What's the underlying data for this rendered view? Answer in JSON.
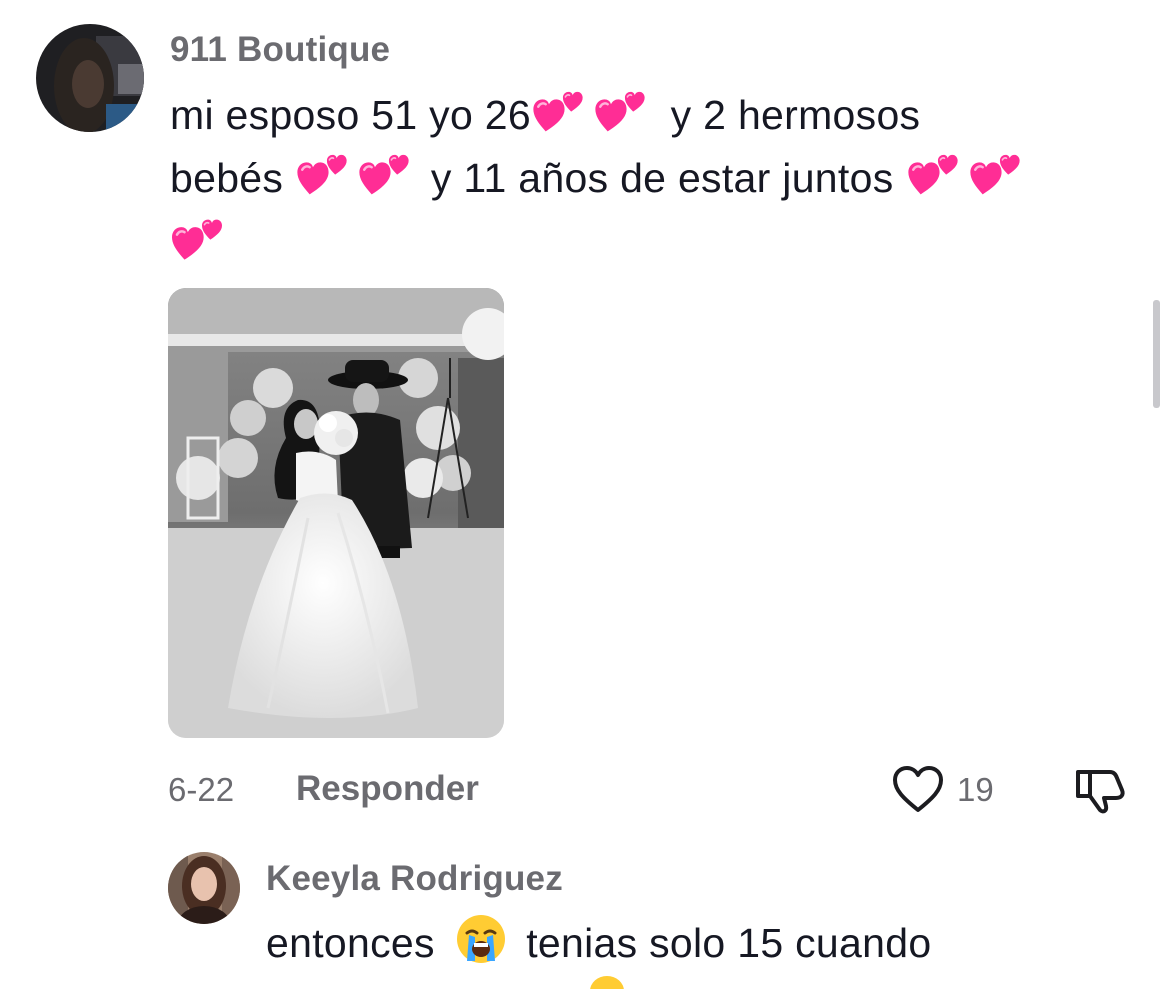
{
  "comment": {
    "username": "911 Boutique",
    "text_line1_a": "mi esposo 51 yo 26",
    "text_line1_b": "y 2 hermosos",
    "text_line2_a": "bebés",
    "text_line2_b": "y 11 años de estar juntos",
    "emoji": "heart-pair-icon",
    "date": "6-22",
    "reply_label": "Responder",
    "like_count": "19"
  },
  "reply": {
    "username": "Keeyla Rodriguez",
    "text_a": "entonces",
    "text_b": "tenias solo 15 cuando",
    "emoji": "loudly-crying-face-icon"
  },
  "colors": {
    "text": "#161823",
    "secondary": "#6b6b70",
    "heart_pink": "#ff2d95"
  }
}
